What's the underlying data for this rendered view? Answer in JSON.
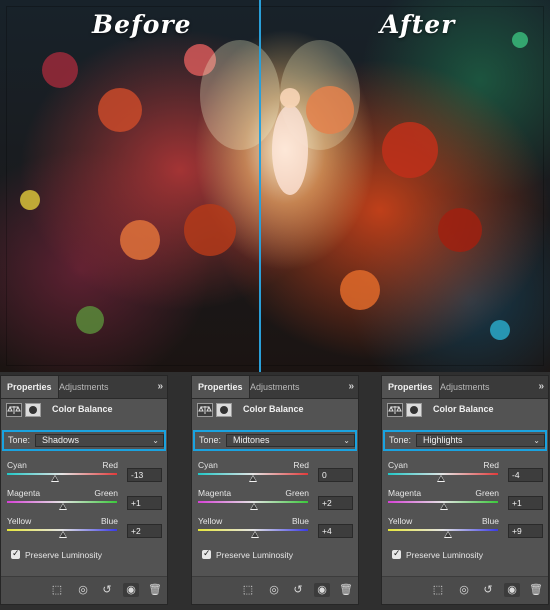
{
  "captions": {
    "before": "Before",
    "after": "After"
  },
  "colors": {
    "accent": "#1aa3e0",
    "panel_bg": "#535353"
  },
  "panels": [
    {
      "tabs": {
        "active": "Properties",
        "inactive": "Adjustments",
        "menu": "»"
      },
      "header": {
        "adjustment_icon": "balance-scale-icon",
        "mask_icon": "layer-mask-icon",
        "title": "Color Balance"
      },
      "tone": {
        "label": "Tone:",
        "value": "Shadows"
      },
      "sliders": [
        {
          "left": "Cyan",
          "right": "Red",
          "value": "-13",
          "level": -13
        },
        {
          "left": "Magenta",
          "right": "Green",
          "value": "+1",
          "level": 1
        },
        {
          "left": "Yellow",
          "right": "Blue",
          "value": "+2",
          "level": 2
        }
      ],
      "preserve_luminosity": {
        "label": "Preserve Luminosity",
        "checked": true
      }
    },
    {
      "tabs": {
        "active": "Properties",
        "inactive": "Adjustments",
        "menu": "»"
      },
      "header": {
        "adjustment_icon": "balance-scale-icon",
        "mask_icon": "layer-mask-icon",
        "title": "Color Balance"
      },
      "tone": {
        "label": "Tone:",
        "value": "Midtones"
      },
      "sliders": [
        {
          "left": "Cyan",
          "right": "Red",
          "value": "0",
          "level": 0
        },
        {
          "left": "Magenta",
          "right": "Green",
          "value": "+2",
          "level": 2
        },
        {
          "left": "Yellow",
          "right": "Blue",
          "value": "+4",
          "level": 4
        }
      ],
      "preserve_luminosity": {
        "label": "Preserve Luminosity",
        "checked": true
      }
    },
    {
      "tabs": {
        "active": "Properties",
        "inactive": "Adjustments",
        "menu": "»"
      },
      "header": {
        "adjustment_icon": "balance-scale-icon",
        "mask_icon": "layer-mask-icon",
        "title": "Color Balance"
      },
      "tone": {
        "label": "Tone:",
        "value": "Highlights"
      },
      "sliders": [
        {
          "left": "Cyan",
          "right": "Red",
          "value": "-4",
          "level": -4
        },
        {
          "left": "Magenta",
          "right": "Green",
          "value": "+1",
          "level": 1
        },
        {
          "left": "Yellow",
          "right": "Blue",
          "value": "+9",
          "level": 9
        }
      ],
      "preserve_luminosity": {
        "label": "Preserve Luminosity",
        "checked": true
      }
    }
  ],
  "footer_icons": [
    "clip-to-layer-icon",
    "view-previous-state-icon",
    "reset-icon",
    "visibility-eye-icon",
    "trash-icon"
  ]
}
